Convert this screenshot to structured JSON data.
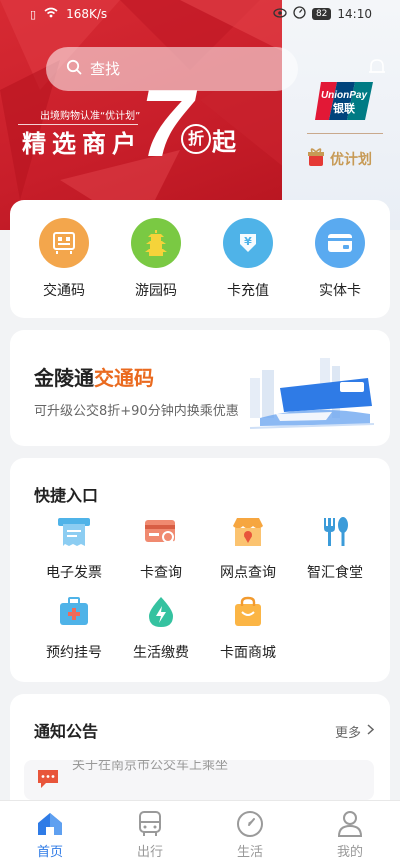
{
  "status_bar": {
    "speed": "168K/s",
    "battery": "82",
    "time": "14:10"
  },
  "search": {
    "placeholder": "查找"
  },
  "banner": {
    "small_text": "出境购物认准“优计划”",
    "headline": "精选商户",
    "number": "7",
    "badge": "折",
    "suffix": "起",
    "plan_label": "优计划"
  },
  "quick_actions": [
    {
      "label": "交通码",
      "icon": "qr-code-icon",
      "color": "#f3a64c"
    },
    {
      "label": "游园码",
      "icon": "pagoda-icon",
      "color": "#7ac943"
    },
    {
      "label": "卡充值",
      "icon": "yuan-download-icon",
      "color": "#4fb3e8"
    },
    {
      "label": "实体卡",
      "icon": "card-icon",
      "color": "#5aaaf0"
    }
  ],
  "promo_card": {
    "title_prefix": "金陵通",
    "title_highlight": "交通码",
    "subtitle": "可升级公交8折+90分钟内换乘优惠"
  },
  "shortcuts": {
    "title": "快捷入口",
    "items": [
      {
        "label": "电子发票",
        "icon": "invoice-icon"
      },
      {
        "label": "卡查询",
        "icon": "card-search-icon"
      },
      {
        "label": "网点查询",
        "icon": "store-location-icon"
      },
      {
        "label": "智汇食堂",
        "icon": "cutlery-icon"
      },
      {
        "label": "预约挂号",
        "icon": "medical-kit-icon"
      },
      {
        "label": "生活缴费",
        "icon": "lightning-drop-icon"
      },
      {
        "label": "卡面商城",
        "icon": "shopping-bag-icon"
      }
    ]
  },
  "notices": {
    "title": "通知公告",
    "more_label": "更多",
    "item_text": "关于在南京市公交车上乘坐"
  },
  "tabs": [
    {
      "label": "首页",
      "icon": "home-icon",
      "active": true
    },
    {
      "label": "出行",
      "icon": "bus-icon",
      "active": false
    },
    {
      "label": "生活",
      "icon": "compass-icon",
      "active": false
    },
    {
      "label": "我的",
      "icon": "user-icon",
      "active": false
    }
  ],
  "colors": {
    "brand_red": "#d72a33",
    "active_tab": "#2f7be6",
    "highlight_orange": "#ea6a1f"
  }
}
